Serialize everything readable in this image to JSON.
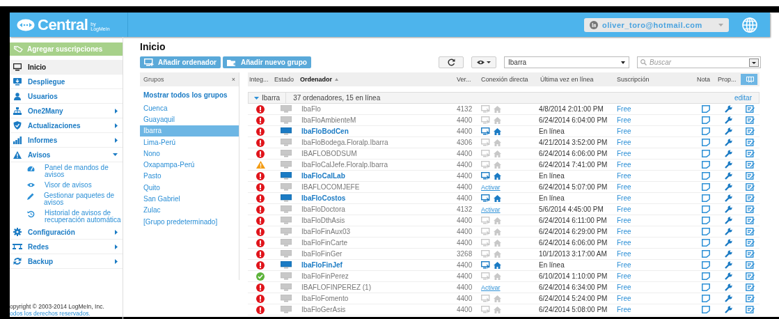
{
  "header": {
    "logo": "Central",
    "logo_by": "by",
    "logo_brand": "LogMeIn",
    "account": "oliver_toro@hotmail.com"
  },
  "sidebar": {
    "promo": "Agregar suscripciones",
    "items": [
      {
        "label": "Inicio",
        "kind": "item",
        "selected": true
      },
      {
        "label": "Despliegue",
        "kind": "item",
        "selected": false
      },
      {
        "label": "Usuarios",
        "kind": "item",
        "selected": false
      },
      {
        "label": "One2Many",
        "kind": "menu",
        "expanded": false,
        "selected": false
      },
      {
        "label": "Actualizaciones",
        "kind": "menu",
        "expanded": false,
        "selected": false
      },
      {
        "label": "Informes",
        "kind": "menu",
        "expanded": false,
        "selected": false
      },
      {
        "label": "Avisos",
        "kind": "menu",
        "expanded": true,
        "selected": false
      },
      {
        "label": "Panel de mandos de avisos",
        "kind": "sub",
        "selected": false
      },
      {
        "label": "Visor de avisos",
        "kind": "sub",
        "selected": false
      },
      {
        "label": "Gestionar paquetes de avisos",
        "kind": "sub",
        "selected": false
      },
      {
        "label": "Historial de avisos de recuperación automática",
        "kind": "sub",
        "selected": false
      },
      {
        "label": "Configuración",
        "kind": "menu",
        "expanded": false,
        "selected": false
      },
      {
        "label": "Redes",
        "kind": "menu",
        "expanded": false,
        "selected": false
      },
      {
        "label": "Backup",
        "kind": "menu",
        "expanded": false,
        "selected": false
      }
    ],
    "copyright": "opyright © 2003-2014 LogMeIn, Inc.",
    "rights": "odos los derechos reservados."
  },
  "main": {
    "title": "Inicio",
    "buttons": [
      "Añadir ordenador",
      "Añadir nuevo grupo"
    ],
    "group_filter": "Ibarra",
    "search": {
      "placeholder": "Buscar"
    }
  },
  "groups": {
    "title": "Grupos",
    "close": "×",
    "all": "Mostrar todos los grupos",
    "items": [
      {
        "label": "Cuenca",
        "selected": false
      },
      {
        "label": "Guayaquil",
        "selected": false
      },
      {
        "label": "Ibarra",
        "selected": true
      },
      {
        "label": "Lima-Perú",
        "selected": false
      },
      {
        "label": "Nono",
        "selected": false
      },
      {
        "label": "Oxapampa-Perú",
        "selected": false
      },
      {
        "label": "Pasto",
        "selected": false
      },
      {
        "label": "Quito",
        "selected": false
      },
      {
        "label": "San Gabriel",
        "selected": false
      },
      {
        "label": "Zulac",
        "selected": false
      },
      {
        "label": "[Grupo predeterminado]",
        "selected": false
      }
    ]
  },
  "table": {
    "columns": [
      "Integ...",
      "Estado",
      "Ordenador",
      "Ver...",
      "Conexión directa",
      "Última vez en línea",
      "Suscripción",
      "Nota",
      "Prop..."
    ],
    "group": {
      "name": "Ibarra",
      "summary": "37 ordenadores, 15 en línea",
      "edit": "editar",
      "expanded": true
    },
    "rows": [
      {
        "kind": "error",
        "online": false,
        "name": "IbaFlo",
        "version": "4132",
        "last": "4/8/2014 2:01:00 PM",
        "subscription": "Free"
      },
      {
        "kind": "error",
        "online": false,
        "name": "IbaFloAmbienteM",
        "version": "4400",
        "last": "6/24/2014 6:04:00 PM",
        "subscription": "Free"
      },
      {
        "kind": "error",
        "online": true,
        "name": "IbaFloBodCen",
        "version": "4400",
        "last": "En línea",
        "subscription": "Free"
      },
      {
        "kind": "error",
        "online": false,
        "name": "IbaFloBodega.Floralp.Ibarra",
        "version": "4306",
        "last": "4/21/2014 3:52:00 PM",
        "subscription": "Free"
      },
      {
        "kind": "error",
        "online": false,
        "name": "IBAFLOBODSUM",
        "version": "4400",
        "last": "6/24/2014 6:06:00 PM",
        "subscription": "Free"
      },
      {
        "kind": "warning",
        "online": false,
        "name": "IbaFloCalJefe.Floralp.Ibarra",
        "version": "4400",
        "last": "6/24/2014 7:41:00 PM",
        "subscription": "Free"
      },
      {
        "kind": "error",
        "online": true,
        "name": "IbaFloCalLab",
        "version": "4400",
        "last": "En línea",
        "subscription": "Free"
      },
      {
        "kind": "error",
        "online": false,
        "name": "IBAFLOCOMJEFE",
        "version": "4400",
        "link": "Activar",
        "last": "6/24/2014 5:07:00 PM",
        "subscription": "Free"
      },
      {
        "kind": "error",
        "online": true,
        "name": "IbaFloCostos",
        "version": "4400",
        "last": "En línea",
        "subscription": "Free"
      },
      {
        "kind": "error",
        "online": false,
        "name": "IbaFloDoctora",
        "version": "4132",
        "link": "Activar",
        "last": "5/6/2014 4:45:00 PM",
        "subscription": "Free"
      },
      {
        "kind": "error",
        "online": false,
        "name": "IbaFloDthAsis",
        "version": "4400",
        "last": "6/24/2014 6:11:00 PM",
        "subscription": "Free"
      },
      {
        "kind": "error",
        "online": false,
        "name": "IbaFloFinAux03",
        "version": "4400",
        "last": "6/24/2014 6:29:00 PM",
        "subscription": "Free"
      },
      {
        "kind": "error",
        "online": false,
        "name": "IbaFloFinCarte",
        "version": "4400",
        "last": "6/24/2014 6:06:00 PM",
        "subscription": "Free"
      },
      {
        "kind": "error",
        "online": false,
        "name": "IbaFloFinGer",
        "version": "3268",
        "last": "10/1/2013 3:17:00 AM",
        "subscription": "Free"
      },
      {
        "kind": "error",
        "online": true,
        "name": "IbaFloFinJef",
        "version": "4400",
        "last": "En línea",
        "subscription": "Free"
      },
      {
        "kind": "ok",
        "online": false,
        "name": "IbaFloFinPerez",
        "version": "4400",
        "last": "6/10/2014 1:10:00 PM",
        "subscription": "Free"
      },
      {
        "kind": "error",
        "online": false,
        "name": "IBAFLOFINPEREZ (1)",
        "version": "4400",
        "link": "Activar",
        "last": "6/24/2014 6:34:00 PM",
        "subscription": "Free"
      },
      {
        "kind": "error",
        "online": false,
        "name": "IbaFloFomento",
        "version": "4400",
        "last": "6/24/2014 5:24:00 PM",
        "subscription": "Free"
      },
      {
        "kind": "error",
        "online": false,
        "name": "IbaFloGerAsis",
        "version": "4400",
        "last": "6/24/2014 5:08:00 PM",
        "subscription": "Free"
      }
    ]
  }
}
